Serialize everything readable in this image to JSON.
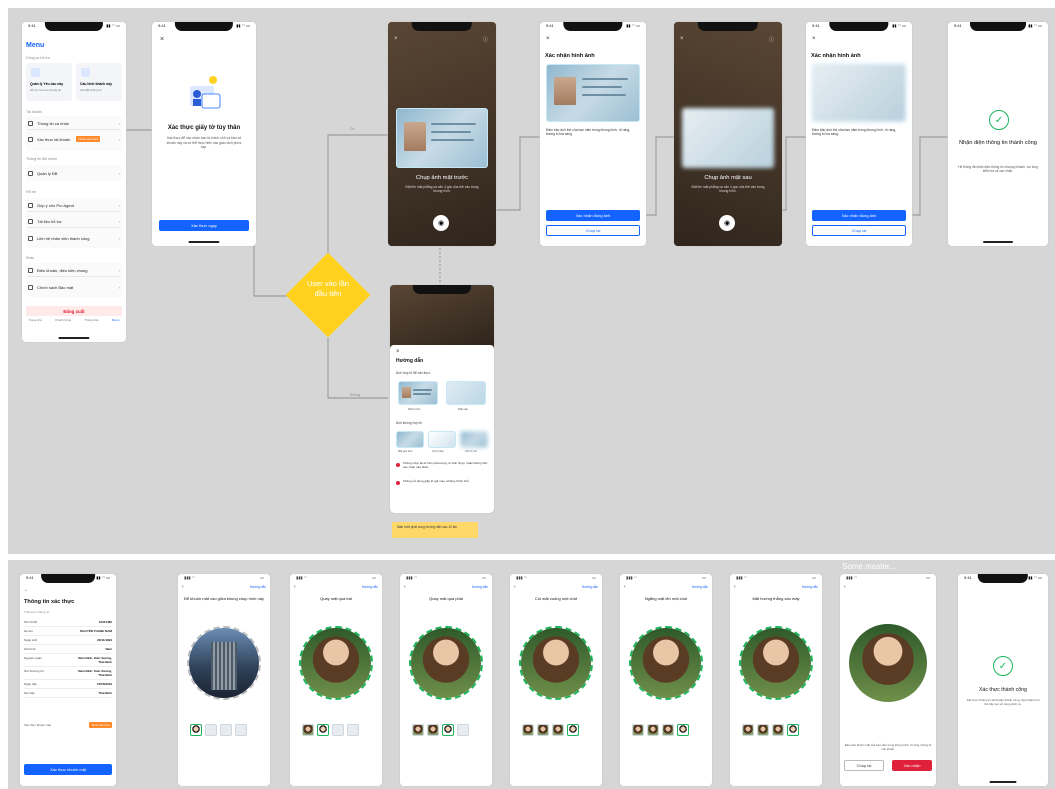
{
  "status_time": "9:41",
  "colors": {
    "primary": "#1463ff",
    "decision": "#ffd21f",
    "success": "#1bb55c",
    "danger": "#e0213b",
    "note": "#ffd86a"
  },
  "menu_screen": {
    "title": "Menu",
    "section_tools": "Công cụ hỗ trợ",
    "tool1_title": "Quản lý Yêu cầu này",
    "tool1_desc": "Hỗ trợ tra cứu thông tin",
    "tool2_title": "Cấu hình khách này",
    "tool2_desc": "Cài đặt thông tin",
    "section_account": "Tài khoản",
    "item_personal": "Thông tin cá nhân",
    "item_verify": "Xác thực tài khoản",
    "verify_badge": "Chưa xác thực",
    "section_team": "Thông tin đội nhóm",
    "item_team": "Quản lý ĐB",
    "section_support": "Hỗ trợ",
    "item_pro": "Góp ý cho Pro Agent",
    "item_docs": "Tài liệu hỗ trợ",
    "item_contact": "Liên hệ nhân viên thành công",
    "section_other": "Khác",
    "item_terms": "Điều khoản, điều kiện chung",
    "item_policy": "Chính sách Bảo mật",
    "logout": "Đăng xuất",
    "tabs": [
      "Trang chủ",
      "Khách hàng",
      "Thông báo",
      "Menu"
    ]
  },
  "verify_intro": {
    "close": "×",
    "title": "Xác thực giấy tờ tùy thân",
    "desc": "Xác thực để xác nhận bạn là chính chủ và bảo vệ khoản này và có thể thực hiện các giao dịch phức tạp.",
    "button": "Xác thực ngay"
  },
  "decision": {
    "label": "User vào lần đầu tiên"
  },
  "capture_front": {
    "title": "Chụp ảnh mặt trước",
    "desc": "Đặt lên mặt phẳng và căn 4 góc của thẻ vào trong khung hình."
  },
  "capture_back": {
    "title": "Chụp ảnh mặt sau",
    "desc": "Đặt lên mặt phẳng và căn 4 góc của thẻ vào trong khung hình."
  },
  "confirm_front": {
    "close": "×",
    "title": "Xác nhận hình ảnh",
    "desc": "Đảm bảo ảnh thẻ của bạn nằm trong khung hình, rõ ràng, không bị lóa sáng.",
    "confirm": "Xác nhận đúng ảnh",
    "retake": "Chụp lại"
  },
  "confirm_back": {
    "close": "×",
    "title": "Xác nhận hình ảnh",
    "desc": "Đảm bảo ảnh thẻ của bạn nằm trong khung hình, rõ ràng, không bị lóa sáng.",
    "confirm": "Xác nhận đúng ảnh",
    "retake": "Chụp lại"
  },
  "success_id": {
    "title": "Nhận diện thông tin thành công",
    "desc": "Hệ thống đã nhận diện thông tin của quý khách, vui lòng kiểm tra và xác nhận."
  },
  "guide": {
    "close": "×",
    "title": "Hướng dẫn",
    "good_label": "Ảnh hợp lệ để xác thực",
    "good_items": [
      "Mặt trước",
      "Mặt sau"
    ],
    "bad_label": "Ảnh không hợp lệ",
    "bad_items": [
      "Mất góc ảnh",
      "Ảnh bị lóa",
      "Ảnh bị mờ"
    ],
    "rule1": "Không chụp lại từ bản photocopy, từ ảnh chụp, hoặc bất kỳ bản sao chép nào khác.",
    "rule2": "Không sử dụng giấy tờ giả mạo, không chính chủ.",
    "note": "Màn lướt phát xong hướng dẫn sau 10 lần"
  },
  "info_screen": {
    "back": "←",
    "title": "Thông tin xác thực",
    "section": "Thông tin chứng từ",
    "fields": [
      {
        "label": "Số CCCD",
        "value": "12344480"
      },
      {
        "label": "Họ tên",
        "value": "NGUYỄN THANH NAM"
      },
      {
        "label": "Ngày sinh",
        "value": "23/11/1994"
      },
      {
        "label": "Giới tính",
        "value": "Nam"
      },
      {
        "label": "Nguyên quán",
        "value": "Nam Bình, Kiến Xương, Thái Bình"
      },
      {
        "label": "Nơi thường trú",
        "value": "Nam Bình, Kiến Xương, Thái Bình"
      },
      {
        "label": "Ngày cấp",
        "value": "15/05/2019"
      },
      {
        "label": "Nơi cấp",
        "value": "Thái Bình"
      }
    ],
    "status_label": "Xác thực khuôn mặt",
    "status_badge": "Chưa xác thực",
    "button": "Xác thực khuôn mặt"
  },
  "face_help": "Hướng dẫn",
  "face_steps": [
    "Để khuôn mặt vào giữa khung chụp hình này",
    "Quay mặt qua trái",
    "Quay mặt qua phải",
    "Cúi mặt xuống một chút",
    "Ngẩng mặt lên một chút",
    "Mặt hướng thẳng vào máy"
  ],
  "face_confirm": {
    "desc": "Đảm bảo khuôn mặt của bạn nằm trong khung hình, rõ ràng, không bị che khuất.",
    "retake": "Chụp lại",
    "confirm": "Xác nhận"
  },
  "face_success": {
    "title": "Xác thực thành công",
    "desc": "Xác thực thông tin tài khoản thành công. Quý khách có thể tiếp tục sử dụng dịch vụ."
  },
  "flow_labels": {
    "no": "Không",
    "yes": "Có"
  },
  "overflow_text": "Some master..."
}
